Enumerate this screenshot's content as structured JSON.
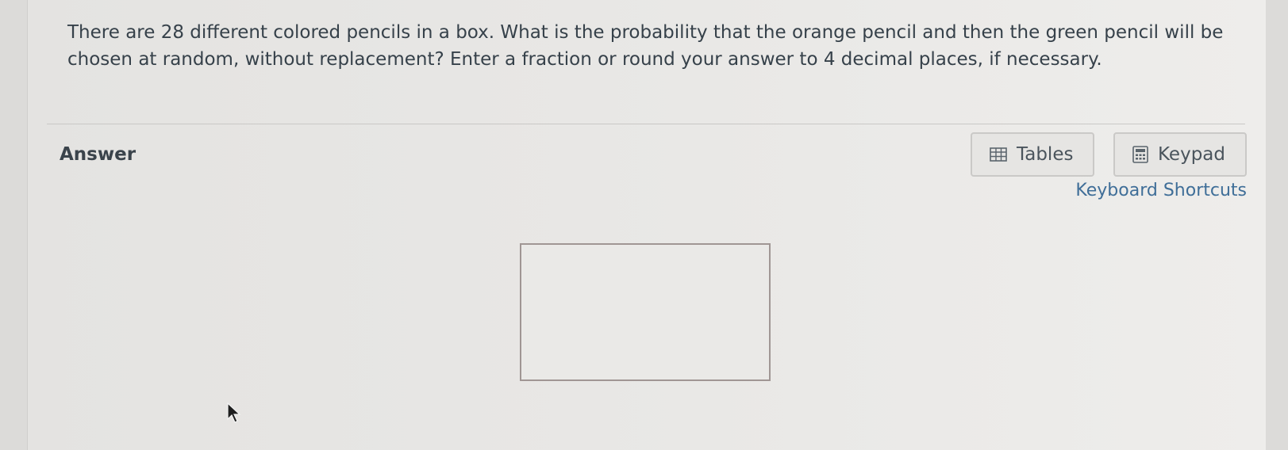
{
  "question": {
    "text": "There are 28 different colored pencils in a box. What is the probability that the orange pencil and then the green pencil will be chosen at random, without replacement? Enter a fraction or round your answer to 4 decimal places, if necessary."
  },
  "answer": {
    "label": "Answer",
    "input_value": ""
  },
  "tools": {
    "tables_label": "Tables",
    "keypad_label": "Keypad",
    "shortcuts_label": "Keyboard Shortcuts",
    "tables_icon": "table-grid-icon",
    "keypad_icon": "calculator-icon"
  },
  "colors": {
    "link": "#3f6e98",
    "input_border": "#a09694"
  }
}
